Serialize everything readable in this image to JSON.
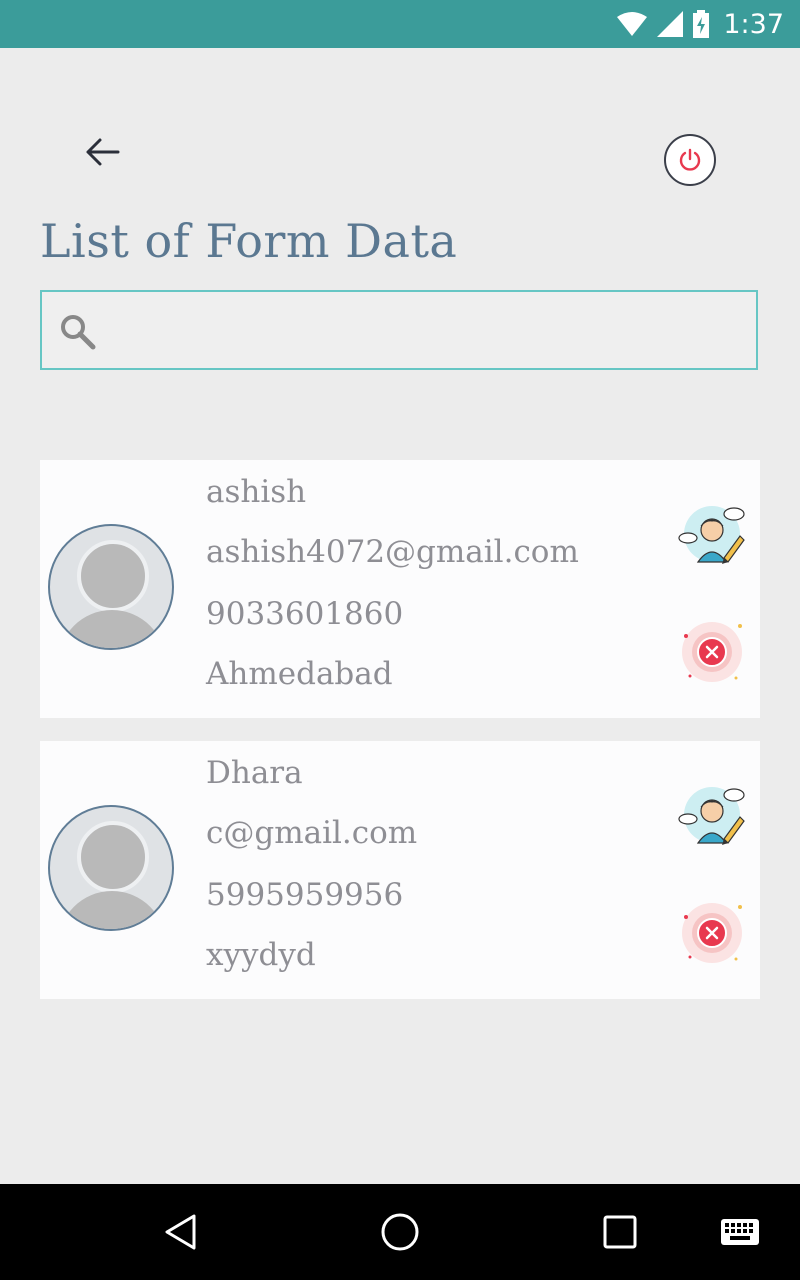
{
  "status_bar": {
    "time": "1:37"
  },
  "header": {
    "title": "List of Form Data"
  },
  "search": {
    "placeholder": "",
    "value": ""
  },
  "records": [
    {
      "name": "ashish",
      "email": "ashish4072@gmail.com",
      "phone": "9033601860",
      "city": "Ahmedabad"
    },
    {
      "name": "Dhara",
      "email": "c@gmail.com",
      "phone": "5995959956",
      "city": "xyydyd"
    }
  ],
  "colors": {
    "accent": "#3b9c9a",
    "title": "#5b7891",
    "search_border": "#66c6c4",
    "delete": "#e8394f",
    "power": "#e8394f"
  },
  "icons": {
    "back": "arrow-left-icon",
    "power": "power-icon",
    "search": "search-icon",
    "avatar": "user-avatar-icon",
    "edit": "edit-user-icon",
    "delete": "delete-icon",
    "nav_back": "triangle-back-icon",
    "nav_home": "circle-home-icon",
    "nav_recent": "square-recents-icon",
    "nav_keyboard": "keyboard-icon"
  }
}
